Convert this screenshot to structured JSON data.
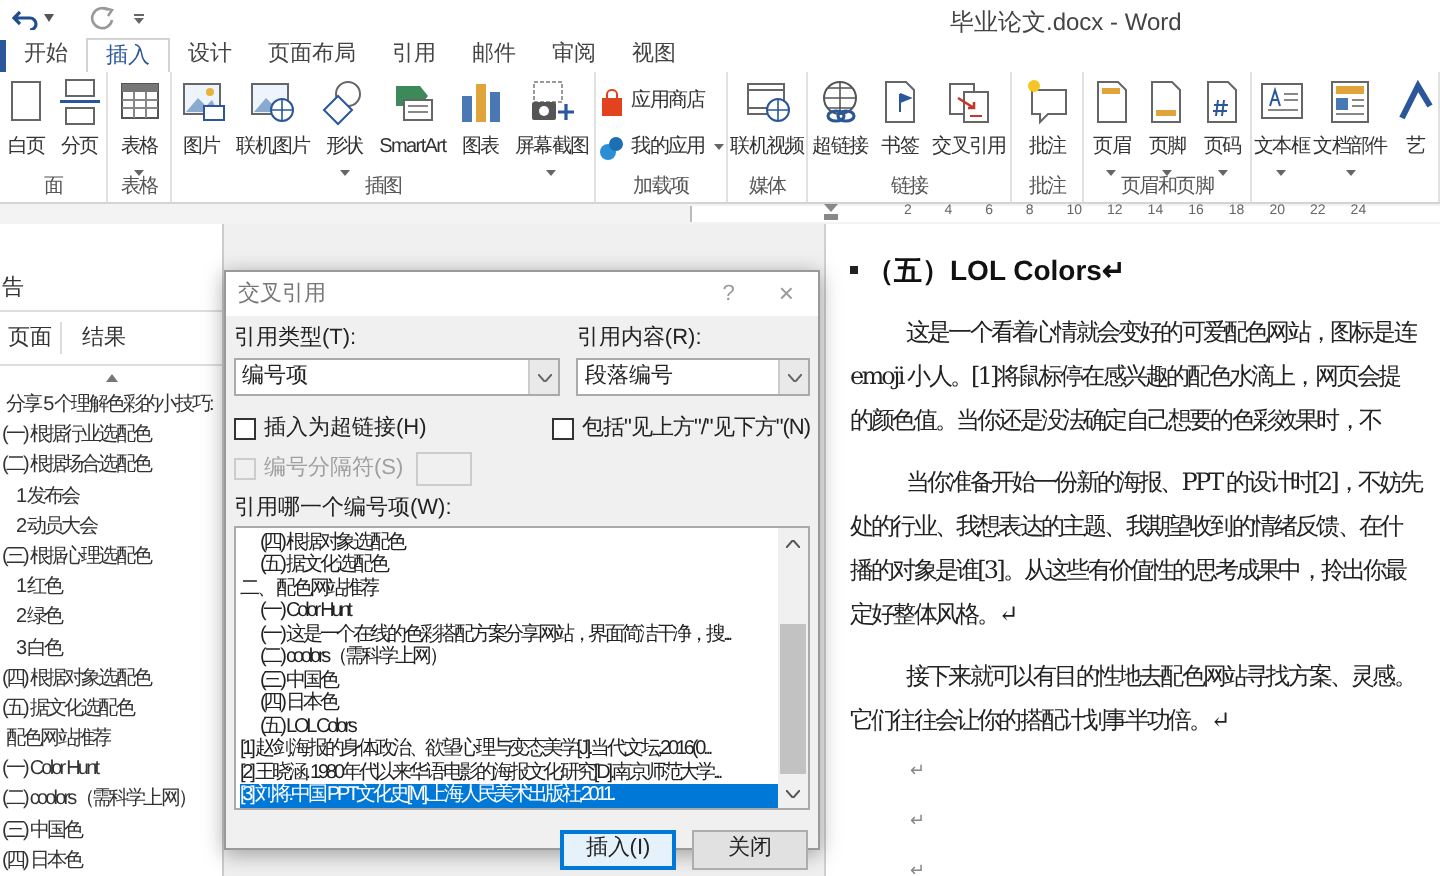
{
  "title_bar": {
    "title": "毕业论文.docx - Word"
  },
  "ribbon_tabs": [
    {
      "label": "开始",
      "selected": false
    },
    {
      "label": "插入",
      "selected": true
    },
    {
      "label": "设计",
      "selected": false
    },
    {
      "label": "页面布局",
      "selected": false
    },
    {
      "label": "引用",
      "selected": false
    },
    {
      "label": "邮件",
      "selected": false
    },
    {
      "label": "审阅",
      "selected": false
    },
    {
      "label": "视图",
      "selected": false
    }
  ],
  "ribbon_groups": [
    {
      "label": "面",
      "commands": [
        {
          "label": "白页",
          "kind": "large",
          "dropdown": false
        },
        {
          "label": "分页",
          "kind": "large",
          "dropdown": false
        }
      ]
    },
    {
      "label": "表格",
      "commands": [
        {
          "label": "表格",
          "kind": "large",
          "dropdown": true
        }
      ]
    },
    {
      "label": "插图",
      "commands": [
        {
          "label": "图片",
          "kind": "large",
          "dropdown": false
        },
        {
          "label": "联机图片",
          "kind": "large",
          "dropdown": false
        },
        {
          "label": "形状",
          "kind": "large",
          "dropdown": true
        },
        {
          "label": "SmartArt",
          "kind": "large",
          "dropdown": false
        },
        {
          "label": "图表",
          "kind": "large",
          "dropdown": false
        },
        {
          "label": "屏幕截图",
          "kind": "large",
          "dropdown": true
        }
      ]
    },
    {
      "label": "加载项",
      "commands": [
        {
          "label": "应用商店",
          "kind": "small",
          "dropdown": false
        },
        {
          "label": "我的应用",
          "kind": "small",
          "dropdown": true
        }
      ]
    },
    {
      "label": "媒体",
      "commands": [
        {
          "label": "联机视频",
          "kind": "large",
          "dropdown": false
        }
      ]
    },
    {
      "label": "链接",
      "commands": [
        {
          "label": "超链接",
          "kind": "large",
          "dropdown": false
        },
        {
          "label": "书签",
          "kind": "large",
          "dropdown": false
        },
        {
          "label": "交叉引用",
          "kind": "large",
          "dropdown": false
        }
      ]
    },
    {
      "label": "批注",
      "commands": [
        {
          "label": "批注",
          "kind": "large",
          "dropdown": false
        }
      ]
    },
    {
      "label": "页眉和页脚",
      "commands": [
        {
          "label": "页眉",
          "kind": "large",
          "dropdown": true
        },
        {
          "label": "页脚",
          "kind": "large",
          "dropdown": true
        },
        {
          "label": "页码",
          "kind": "large",
          "dropdown": true
        }
      ]
    },
    {
      "commands": [
        {
          "label": "文本框",
          "kind": "large",
          "dropdown": true
        },
        {
          "label": "文档部件",
          "kind": "large",
          "dropdown": true
        },
        {
          "label": "艺",
          "kind": "large",
          "dropdown": false
        }
      ]
    }
  ],
  "ruler": {
    "numbers": [
      "2",
      "4",
      "6",
      "8",
      "10",
      "12",
      "14",
      "16",
      "18",
      "20",
      "22",
      "24"
    ]
  },
  "navigation_pane": {
    "header": "告",
    "tabs": [
      "页面",
      "结果"
    ],
    "headings": [
      {
        "text": "分享 5 个理解色彩的小技巧:",
        "children": [
          {
            "text": "(一) 根据行业选配色"
          },
          {
            "text": "(二) 根据场合选配色",
            "children": [
              {
                "text": "1 发布会"
              },
              {
                "text": "2 动员大会"
              }
            ]
          },
          {
            "text": "(三) 根据心理选配色",
            "children": [
              {
                "text": "1 红色"
              },
              {
                "text": "2 绿色"
              },
              {
                "text": "3 白色"
              }
            ]
          },
          {
            "text": "(四) 根据对象选配色"
          },
          {
            "text": "(五) 据文化选配色"
          }
        ]
      },
      {
        "text": "配色网站推荐",
        "children": [
          {
            "text": "(一) Color Hunt"
          },
          {
            "text": "(二) coolors（需科学上网）"
          },
          {
            "text": "(三) 中国色"
          },
          {
            "text": "(四) 日本色"
          }
        ]
      }
    ]
  },
  "dialog": {
    "title": "交叉引用",
    "help": "?",
    "close": "×",
    "reference_type": {
      "label": "引用类型(T):",
      "value": "编号项"
    },
    "reference_content": {
      "label": "引用内容(R):",
      "value": "段落编号"
    },
    "insert_as_hyperlink": {
      "label": "插入为超链接(H)",
      "checked": false
    },
    "include_above_below": {
      "label": "包括\"见上方\"/\"见下方\"(N)",
      "checked": false
    },
    "separator": {
      "label": "编号分隔符(S)",
      "checked": false,
      "disabled": true
    },
    "list_label": "引用哪一个编号项(W):",
    "items": [
      {
        "text": "(四)  根据对象选配色",
        "selected": false
      },
      {
        "text": "(五)  据文化选配色",
        "selected": false
      },
      {
        "text": "二、 配色网站推荐",
        "selected": false
      },
      {
        "text": "(一)  Color Hunt",
        "selected": false
      },
      {
        "text": "(一)  这是一个在线的色彩搭配方案分享网站，界面简洁干净，搜...",
        "selected": false
      },
      {
        "text": "(二)  coolors（需科学上网）",
        "selected": false
      },
      {
        "text": "(三)  中国色",
        "selected": false
      },
      {
        "text": "(四)  日本色",
        "selected": false
      },
      {
        "text": "(五)  LOL Colors",
        "selected": false
      },
      {
        "text": "[1] 赵剑.海报的身体政治、欲望心理与变态美学[J].当代文坛,2016(0...",
        "selected": false
      },
      {
        "text": "[2] 王晓涵. 1980年代以来华语电影的海报文化研究[D].南京师范大学...",
        "selected": false
      },
      {
        "text": "[3] 刘将.中国 PPT文化史[M].上海人民美术出版社,2011.",
        "selected": true
      }
    ],
    "buttons": [
      {
        "label": "插入(I)",
        "default": true
      },
      {
        "label": "关闭",
        "default": false
      }
    ]
  },
  "document": {
    "heading": "（五）LOL Colors↵",
    "paragraphs": [
      {
        "lines": [
          "这是一个看着心情就会变好的可爱配色网站，图标是连",
          "emoji  小人。[1]将鼠标停在感兴趣的配色水滴上，网页会提",
          "的颜色值。当你还是没法确定自己想要的色彩效果时，不"
        ]
      },
      {
        "lines": [
          "当你准备开始一份新的海报、PPT 的设计时[2]，不妨先",
          "处的行业、我想表达的主题、我期望收到的情绪反馈、在什",
          "播的对象是谁[3]。从这些有价值性的思考成果中，拎出你最",
          "定好整体风格。↵"
        ]
      },
      {
        "lines": [
          "接下来就可以有目的性地去配色网站寻找方案、灵感。",
          "它们往往会让你的搭配计划事半功倍。↵"
        ]
      }
    ],
    "empty_paragraphs": [
      "↵",
      "↵",
      "↵"
    ]
  }
}
